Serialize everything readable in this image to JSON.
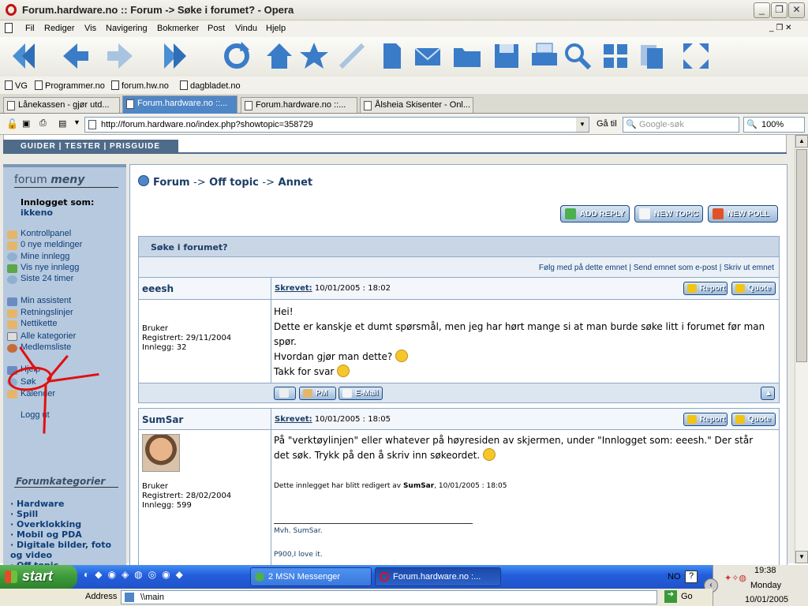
{
  "window": {
    "title": "Forum.hardware.no :: Forum -> Søke i forumet? - Opera"
  },
  "menu": [
    "Fil",
    "Rediger",
    "Vis",
    "Navigering",
    "Bokmerker",
    "Post",
    "Vindu",
    "Hjelp"
  ],
  "toolbar_icons": [
    "back-double-icon",
    "back-icon",
    "forward-icon",
    "fast-forward-icon",
    "reload-icon",
    "home-icon",
    "bookmark-star-icon",
    "pen-icon",
    "document-icon",
    "mail-icon",
    "folder-icon",
    "save-icon",
    "print-icon",
    "search-icon",
    "windows-icon",
    "copy-icon",
    "fullscreen-icon"
  ],
  "bookmarks": [
    "VG",
    "Programmer.no",
    "forum.hw.no",
    "dagbladet.no"
  ],
  "tabs": [
    "Lånekassen - gjør utd...",
    "Forum.hardware.no ::...",
    "Forum.hardware.no ::...",
    "Ålsheia Skisenter - Onl..."
  ],
  "address": {
    "url": "http://forum.hardware.no/index.php?showtopic=358729",
    "go_label": "Gå til",
    "search_placeholder": "Google-søk",
    "zoom": "100%"
  },
  "site_nav": "GUIDER | TESTER | PRISGUIDE",
  "sidebar": {
    "title_a": "forum",
    "title_b": "meny",
    "logged_label": "Innlogget som:",
    "username": "ikkeno",
    "links1": [
      "Kontrollpanel",
      "0 nye meldinger",
      "Mine innlegg",
      "Vis nye innlegg",
      "Siste 24 timer"
    ],
    "links2": [
      "Min assistent",
      "Retningslinjer",
      "Nettikette",
      "Alle kategorier",
      "Medlemsliste"
    ],
    "links3": [
      "Hjelp",
      "Søk",
      "Kalender"
    ],
    "logout": "Logg ut",
    "categories_title": "Forumkategorier",
    "categories": [
      "Hardware",
      "Spill",
      "Overklokking",
      "Mobil og PDA",
      "Digitale bilder, foto og video",
      "Off topic"
    ]
  },
  "breadcrumb": {
    "a": "Forum",
    "b": "Off topic",
    "c": "Annet",
    "sep": "->"
  },
  "actions": {
    "add_reply": "ADD REPLY",
    "new_topic": "NEW TOPIC",
    "new_poll": "NEW POLL"
  },
  "topic": {
    "title": "Søke i forumet?",
    "options": "Følg med på dette emnet | Send emnet som e-post | Skriv ut emnet"
  },
  "posts": [
    {
      "author": "eeesh",
      "written_label": "Skrevet:",
      "date": "10/01/2005 : 18:02",
      "role": "Bruker",
      "registered": "Registrert: 29/11/2004",
      "count": "Innlegg: 32",
      "lines": [
        "Hei!",
        "Dette er kanskje et dumt spørsmål, men jeg har hørt mange si at man burde søke litt i forumet før man spør.",
        "Hvordan gjør man dette?",
        "Takk for svar"
      ],
      "report": "Report",
      "quote": "Quote",
      "pm": "PM",
      "email": "E-Mail"
    },
    {
      "author": "SumSar",
      "written_label": "Skrevet:",
      "date": "10/01/2005 : 18:05",
      "role": "Bruker",
      "registered": "Registrert: 28/02/2004",
      "count": "Innlegg: 599",
      "text": "På \"verktøylinjen\" eller whatever på høyresiden av skjermen, under \"Innlogget som: eeesh.\" Der står det søk. Trykk på den å skriv inn søkeordet.",
      "edited_a": "Dette innlegget har blitt redigert av ",
      "edited_b": "SumSar",
      "edited_c": ", 10/01/2005 : 18:05",
      "sig1": "Mvh. SumSar.",
      "sig2": "P900,I love it.",
      "report": "Report",
      "quote": "Quote"
    }
  ],
  "taskbar": {
    "start": "start",
    "msn": "2 MSN Messenger",
    "forum": "Forum.hardware.no :...",
    "lang": "NO",
    "time": "19:38",
    "day": "Monday",
    "date": "10/01/2005"
  },
  "address_row": {
    "label": "Address",
    "value": "\\\\main",
    "go": "Go"
  },
  "colors": {
    "link": "#0d3e7a",
    "sidebar": "#b7c9de",
    "annotation": "#e01010",
    "accent": "#4f86c6"
  }
}
